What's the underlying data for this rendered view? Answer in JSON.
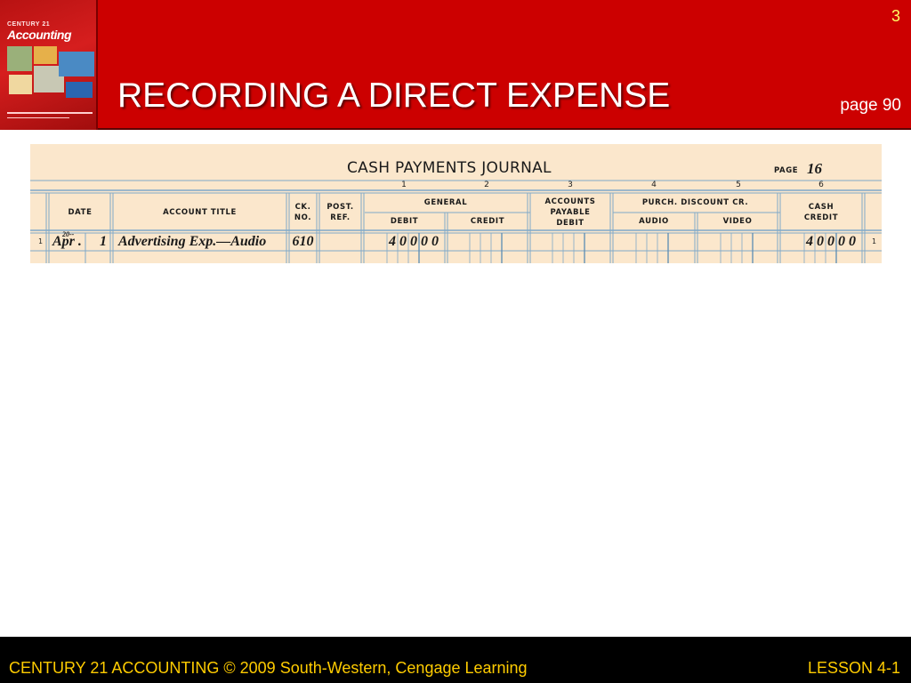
{
  "header": {
    "title": "RECORDING A DIRECT EXPENSE",
    "slide_number": "3",
    "page_ref": "page 90",
    "book_cover": {
      "series_text": "CENTURY 21",
      "title_text": "Accounting"
    },
    "colors": {
      "background": "#cc0000",
      "slide_number": "#ffff66"
    }
  },
  "journal": {
    "title": "CASH PAYMENTS JOURNAL",
    "page_label": "PAGE",
    "page_number": "16",
    "column_numbers": [
      "1",
      "2",
      "3",
      "4",
      "5",
      "6"
    ],
    "headers": {
      "date": "DATE",
      "account_title": "ACCOUNT TITLE",
      "ck_no_1": "CK.",
      "ck_no_2": "NO.",
      "post_ref_1": "POST.",
      "post_ref_2": "REF.",
      "general": "GENERAL",
      "debit": "DEBIT",
      "credit": "CREDIT",
      "ap_1": "ACCOUNTS",
      "ap_2": "PAYABLE",
      "ap_3": "DEBIT",
      "purch_discount": "PURCH. DISCOUNT CR.",
      "audio": "AUDIO",
      "video": "VIDEO",
      "cash_1": "CASH",
      "cash_2": "CREDIT"
    },
    "rows": [
      {
        "line": "1",
        "year": "20--",
        "month": "Apr .",
        "day": "1",
        "account_title": "Advertising Exp.—Audio",
        "ck_no": "610",
        "general_debit": "40000",
        "cash_credit": "40000"
      }
    ]
  },
  "footer": {
    "left": "CENTURY 21 ACCOUNTING © 2009 South-Western, Cengage Learning",
    "right": "LESSON  4-1",
    "color": "#ffcc00"
  }
}
